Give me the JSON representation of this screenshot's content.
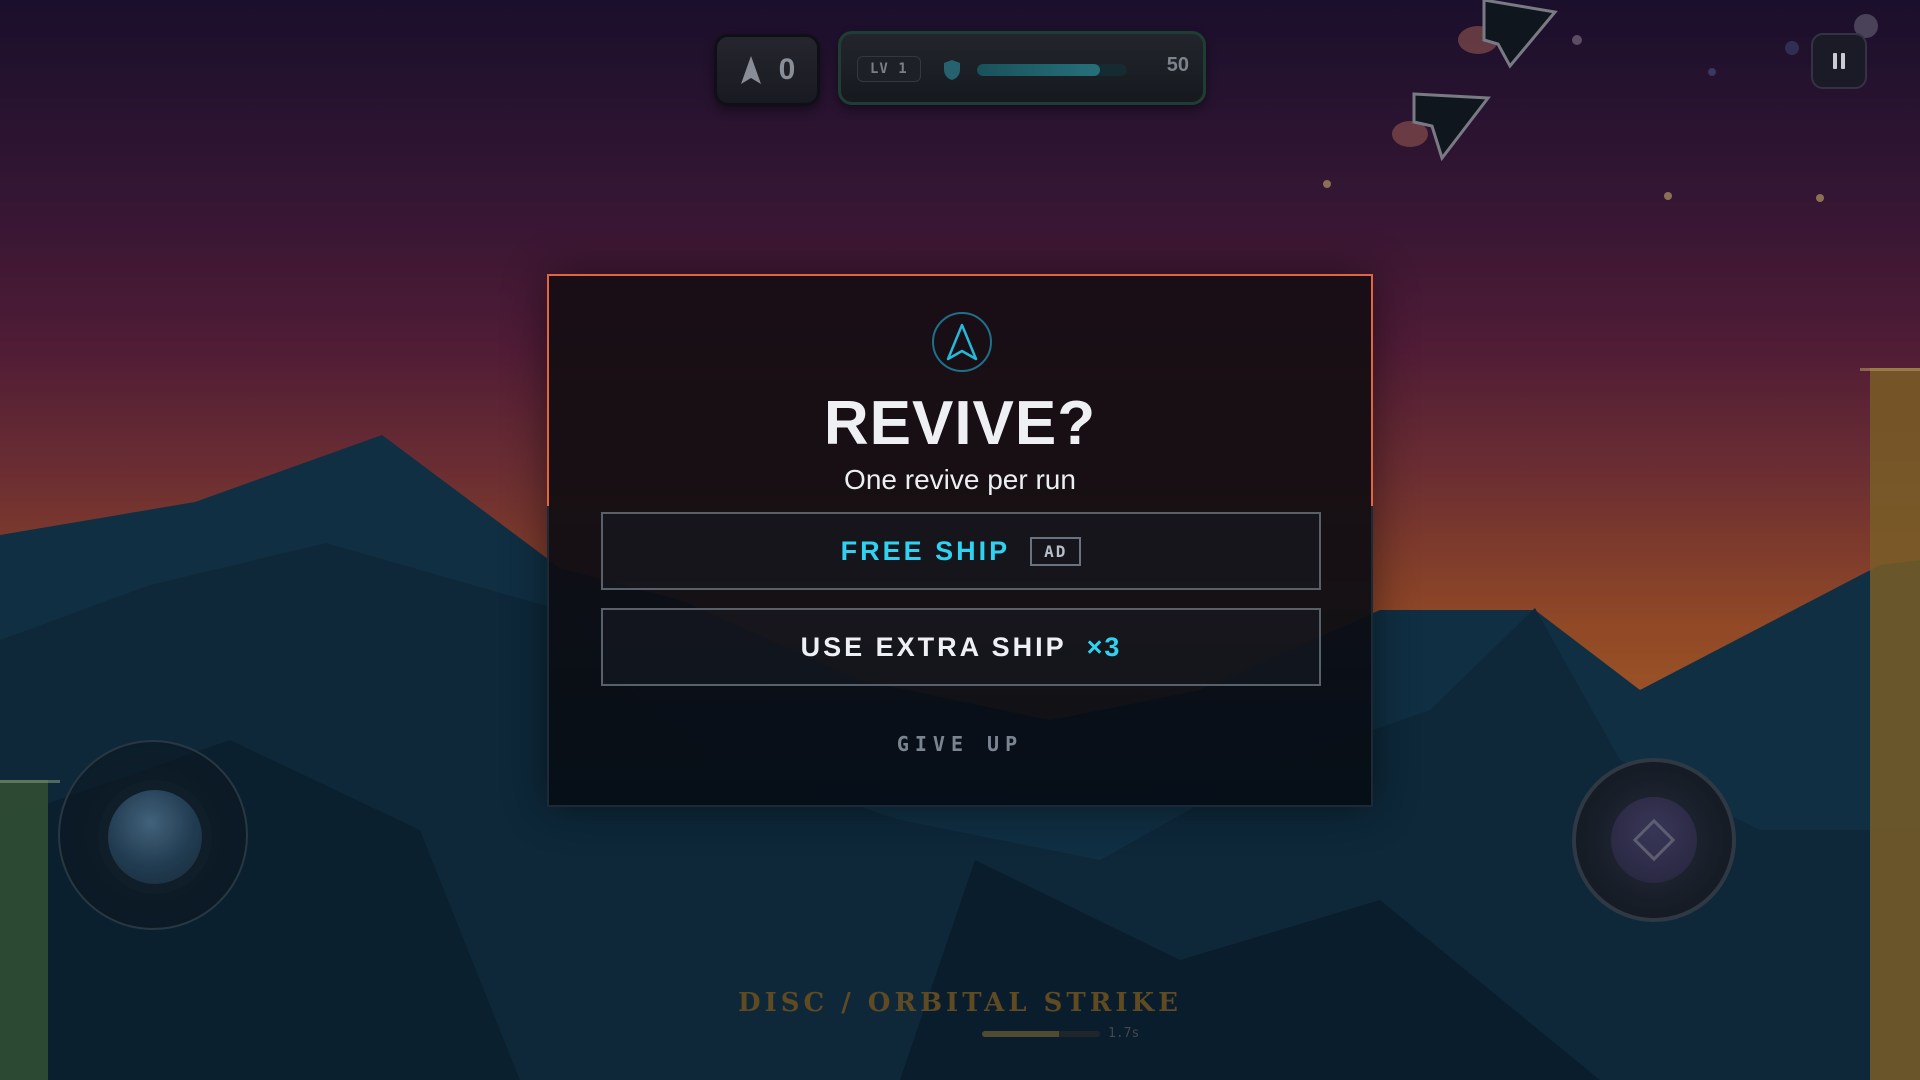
{
  "hud": {
    "ships_icon": "ship-icon",
    "ships_count": "0",
    "level_label": "LV 1",
    "shield_icon": "shield-icon",
    "health_fraction": 0.82,
    "health_value": "50",
    "pause_icon": "pause-icon"
  },
  "modal": {
    "emblem_icon": "ship-emblem-icon",
    "title": "REVIVE?",
    "subtitle": "One revive per run",
    "free_ship_label": "FREE SHIP",
    "ad_tag": "AD",
    "extra_ship_label": "USE EXTRA SHIP",
    "extra_ship_count": "×3",
    "give_up_label": "GIVE UP"
  },
  "weapon": {
    "name": "DISC / ORBITAL STRIKE",
    "cooldown_fraction": 0.65,
    "cooldown_text": "1.7s"
  },
  "colors": {
    "accent_cyan": "#2fd2f0",
    "modal_border": "#e0663f",
    "sky_top": "#1d1130",
    "sky_horizon": "#b8672a"
  }
}
